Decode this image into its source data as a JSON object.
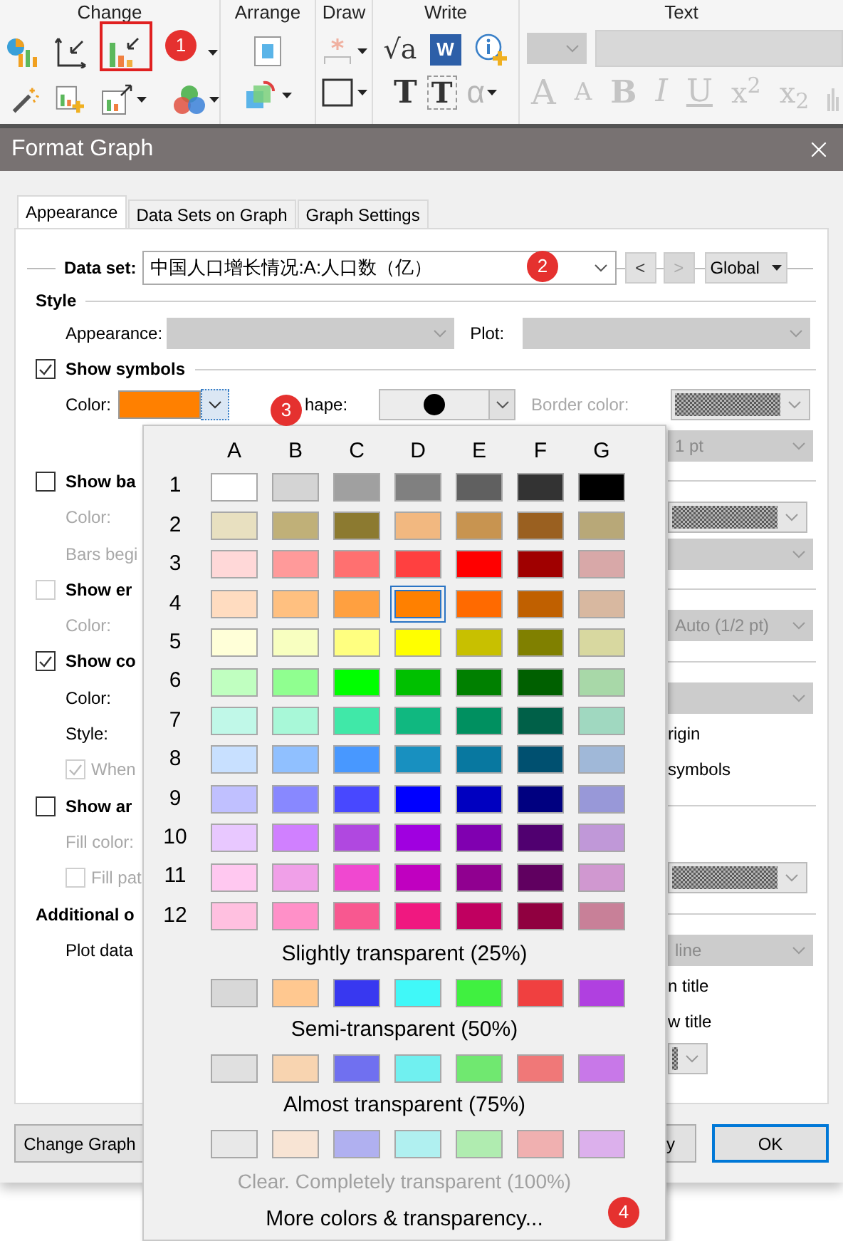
{
  "ribbon": {
    "groups": [
      {
        "label": "Change"
      },
      {
        "label": "Arrange"
      },
      {
        "label": "Draw"
      },
      {
        "label": "Write"
      },
      {
        "label": "Text"
      }
    ],
    "write_tools": [
      {
        "label": "√a",
        "disabled": false
      },
      {
        "label": "W",
        "disabled": false
      },
      {
        "label": "T",
        "disabled": false
      },
      {
        "label": "T",
        "disabled": false
      },
      {
        "label": "α",
        "disabled": true
      }
    ],
    "text_tools": [
      {
        "label": "A",
        "disabled": true
      },
      {
        "label": "A",
        "disabled": true
      },
      {
        "label": "B",
        "disabled": true
      },
      {
        "label": "I",
        "disabled": true
      },
      {
        "label": "U",
        "disabled": true
      },
      {
        "label": "x$^{2}$",
        "disabled": true
      },
      {
        "label": "x$_{2}$",
        "disabled": true
      }
    ]
  },
  "dialog": {
    "title": "Format Graph",
    "tabs": [
      {
        "label": "Appearance",
        "selected": true
      },
      {
        "label": "Data Sets on Graph",
        "selected": false
      },
      {
        "label": "Graph Settings",
        "selected": false
      }
    ],
    "data_set": {
      "label": "Data set:",
      "value": "中国人口增长情况:A:人口数（亿）",
      "prev": {
        "label": "<",
        "disabled": false
      },
      "next": {
        "label": ">",
        "disabled": true
      },
      "scope": "Global"
    },
    "style": {
      "heading": "Style",
      "appearance_label": "Appearance:",
      "plot_label": "Plot:"
    },
    "show_symbols": {
      "label": "Show symbols",
      "checked": true
    },
    "symbol_row": {
      "color_label": "Color:",
      "color": "#ff8000",
      "shape_label": "hape:",
      "border_label": "Border color:"
    },
    "rows": [
      {
        "right": {
          "kind": "combo",
          "value": "1 pt"
        }
      },
      {
        "left": {
          "kind": "check",
          "label": "Show ba",
          "checked": false,
          "disabled": false
        },
        "right": {
          "kind": "rule"
        }
      },
      {
        "left": {
          "kind": "label",
          "label": "Color:",
          "disabled": true
        },
        "right": {
          "kind": "hatched"
        }
      },
      {
        "left": {
          "kind": "label",
          "label": "Bars begi",
          "disabled": true
        },
        "right": {
          "kind": "combo"
        }
      },
      {
        "left": {
          "kind": "check",
          "label": "Show er",
          "checked": false,
          "disabled": true
        },
        "right": {
          "kind": "rule"
        }
      },
      {
        "left": {
          "kind": "label",
          "label": "Color:",
          "disabled": true
        },
        "right": {
          "kind": "combo",
          "value": "Auto (1/2 pt)"
        }
      },
      {
        "left": {
          "kind": "check",
          "label": "Show co",
          "checked": true,
          "disabled": false
        },
        "right": {
          "kind": "rule"
        }
      },
      {
        "left": {
          "kind": "label",
          "label": "Color:",
          "disabled": false
        },
        "right": {
          "kind": "combo"
        }
      },
      {
        "left": {
          "kind": "label",
          "label": "Style:",
          "disabled": false
        },
        "right": {
          "kind": "text",
          "label": "rigin"
        }
      },
      {
        "left": {
          "kind": "subcheck",
          "label": "When",
          "checked": true,
          "disabled": true
        },
        "right": {
          "kind": "text",
          "label": "symbols"
        }
      },
      {
        "left": {
          "kind": "check",
          "label": "Show ar",
          "checked": false,
          "disabled": false
        },
        "right": {
          "kind": "rule"
        }
      },
      {
        "left": {
          "kind": "label",
          "label": "Fill color:",
          "disabled": true
        }
      },
      {
        "left": {
          "kind": "subcheck",
          "label": "Fill pat",
          "checked": false,
          "disabled": true
        },
        "right": {
          "kind": "hatched"
        }
      },
      {
        "left": {
          "kind": "heading",
          "label": "Additional o"
        },
        "right": {
          "kind": "rule"
        }
      },
      {
        "left": {
          "kind": "label",
          "label": "Plot data",
          "disabled": false
        },
        "right": {
          "kind": "combo",
          "value": "line"
        }
      },
      {
        "right": {
          "kind": "text",
          "label": "n title"
        }
      },
      {
        "right": {
          "kind": "text",
          "label": "w title"
        }
      },
      {
        "right": {
          "kind": "hatched_small"
        }
      }
    ],
    "buttons": [
      {
        "label": "Change Graph",
        "default": false
      },
      {
        "label": "y",
        "default": false
      },
      {
        "label": "OK",
        "default": true
      }
    ]
  },
  "color_menu": {
    "columns": [
      "A",
      "B",
      "C",
      "D",
      "E",
      "F",
      "G"
    ],
    "rows": [
      {
        "label": "1",
        "swatches": [
          {
            "color": "#ffffff",
            "selected": false
          },
          {
            "color": "#d4d4d4",
            "selected": false
          },
          {
            "color": "#a0a0a0",
            "selected": false
          },
          {
            "color": "#808080",
            "selected": false
          },
          {
            "color": "#606060",
            "selected": false
          },
          {
            "color": "#333333",
            "selected": false
          },
          {
            "color": "#000000",
            "selected": false
          }
        ]
      },
      {
        "label": "2",
        "swatches": [
          {
            "color": "#e8e0c0",
            "selected": false
          },
          {
            "color": "#c0b078",
            "selected": false
          },
          {
            "color": "#8c7a30",
            "selected": false
          },
          {
            "color": "#f2b880",
            "selected": false
          },
          {
            "color": "#c89450",
            "selected": false
          },
          {
            "color": "#9a6020",
            "selected": false
          },
          {
            "color": "#b8a878",
            "selected": false
          }
        ]
      },
      {
        "label": "3",
        "swatches": [
          {
            "color": "#ffd8d8",
            "selected": false
          },
          {
            "color": "#ff9a9a",
            "selected": false
          },
          {
            "color": "#ff7070",
            "selected": false
          },
          {
            "color": "#ff4040",
            "selected": false
          },
          {
            "color": "#ff0000",
            "selected": false
          },
          {
            "color": "#a00000",
            "selected": false
          },
          {
            "color": "#d8a8a8",
            "selected": false
          }
        ]
      },
      {
        "label": "4",
        "swatches": [
          {
            "color": "#ffdcc0",
            "selected": false
          },
          {
            "color": "#ffc080",
            "selected": false
          },
          {
            "color": "#ffa040",
            "selected": false
          },
          {
            "color": "#ff8000",
            "selected": true
          },
          {
            "color": "#ff6a00",
            "selected": false
          },
          {
            "color": "#c06000",
            "selected": false
          },
          {
            "color": "#d8b8a0",
            "selected": false
          }
        ]
      },
      {
        "label": "5",
        "swatches": [
          {
            "color": "#ffffd8",
            "selected": false
          },
          {
            "color": "#f8ffc0",
            "selected": false
          },
          {
            "color": "#ffff80",
            "selected": false
          },
          {
            "color": "#ffff00",
            "selected": false
          },
          {
            "color": "#c8c000",
            "selected": false
          },
          {
            "color": "#808000",
            "selected": false
          },
          {
            "color": "#d8d8a0",
            "selected": false
          }
        ]
      },
      {
        "label": "6",
        "swatches": [
          {
            "color": "#c0ffc0",
            "selected": false
          },
          {
            "color": "#90ff90",
            "selected": false
          },
          {
            "color": "#00ff00",
            "selected": false
          },
          {
            "color": "#00c000",
            "selected": false
          },
          {
            "color": "#008000",
            "selected": false
          },
          {
            "color": "#006000",
            "selected": false
          },
          {
            "color": "#a8d8a8",
            "selected": false
          }
        ]
      },
      {
        "label": "7",
        "swatches": [
          {
            "color": "#c0f8e8",
            "selected": false
          },
          {
            "color": "#a8f8d8",
            "selected": false
          },
          {
            "color": "#40e8a8",
            "selected": false
          },
          {
            "color": "#10b880",
            "selected": false
          },
          {
            "color": "#009060",
            "selected": false
          },
          {
            "color": "#006048",
            "selected": false
          },
          {
            "color": "#a0d8c0",
            "selected": false
          }
        ]
      },
      {
        "label": "8",
        "swatches": [
          {
            "color": "#c8e0ff",
            "selected": false
          },
          {
            "color": "#90c0ff",
            "selected": false
          },
          {
            "color": "#4898ff",
            "selected": false
          },
          {
            "color": "#1890c0",
            "selected": false
          },
          {
            "color": "#0878a0",
            "selected": false
          },
          {
            "color": "#005070",
            "selected": false
          },
          {
            "color": "#a0b8d8",
            "selected": false
          }
        ]
      },
      {
        "label": "9",
        "swatches": [
          {
            "color": "#c0c0ff",
            "selected": false
          },
          {
            "color": "#8888ff",
            "selected": false
          },
          {
            "color": "#4848ff",
            "selected": false
          },
          {
            "color": "#0000ff",
            "selected": false
          },
          {
            "color": "#0000c0",
            "selected": false
          },
          {
            "color": "#000080",
            "selected": false
          },
          {
            "color": "#9898d8",
            "selected": false
          }
        ]
      },
      {
        "label": "10",
        "swatches": [
          {
            "color": "#e8c8ff",
            "selected": false
          },
          {
            "color": "#d080ff",
            "selected": false
          },
          {
            "color": "#b048e0",
            "selected": false
          },
          {
            "color": "#a000e0",
            "selected": false
          },
          {
            "color": "#8000b0",
            "selected": false
          },
          {
            "color": "#500070",
            "selected": false
          },
          {
            "color": "#c098d8",
            "selected": false
          }
        ]
      },
      {
        "label": "11",
        "swatches": [
          {
            "color": "#ffc8f0",
            "selected": false
          },
          {
            "color": "#f0a0e8",
            "selected": false
          },
          {
            "color": "#f048d0",
            "selected": false
          },
          {
            "color": "#c000c0",
            "selected": false
          },
          {
            "color": "#900090",
            "selected": false
          },
          {
            "color": "#600060",
            "selected": false
          },
          {
            "color": "#d098d0",
            "selected": false
          }
        ]
      },
      {
        "label": "12",
        "swatches": [
          {
            "color": "#ffc0e0",
            "selected": false
          },
          {
            "color": "#ff90c8",
            "selected": false
          },
          {
            "color": "#f85890",
            "selected": false
          },
          {
            "color": "#f01880",
            "selected": false
          },
          {
            "color": "#c00060",
            "selected": false
          },
          {
            "color": "#900040",
            "selected": false
          },
          {
            "color": "#c88098",
            "selected": false
          }
        ]
      }
    ],
    "transparency": [
      {
        "title": "Slightly transparent (25%)",
        "swatches": [
          {
            "color": "#d8d8d8",
            "selected": false
          },
          {
            "color": "#ffc890",
            "selected": false
          },
          {
            "color": "#3838f0",
            "selected": false
          },
          {
            "color": "#40f8f8",
            "selected": false
          },
          {
            "color": "#40f040",
            "selected": false
          },
          {
            "color": "#f04040",
            "selected": false
          },
          {
            "color": "#b040e0",
            "selected": false
          }
        ]
      },
      {
        "title": "Semi-transparent (50%)",
        "swatches": [
          {
            "color": "#e0e0e0",
            "selected": false
          },
          {
            "color": "#f8d4b0",
            "selected": false
          },
          {
            "color": "#7070f0",
            "selected": false
          },
          {
            "color": "#70f0f0",
            "selected": false
          },
          {
            "color": "#70e870",
            "selected": false
          },
          {
            "color": "#f07878",
            "selected": false
          },
          {
            "color": "#c878e8",
            "selected": false
          }
        ]
      },
      {
        "title": "Almost transparent (75%)",
        "swatches": [
          {
            "color": "#e8e8e8",
            "selected": false
          },
          {
            "color": "#f8e4d4",
            "selected": false
          },
          {
            "color": "#b0b0f0",
            "selected": false
          },
          {
            "color": "#b0f0f0",
            "selected": false
          },
          {
            "color": "#b0ecb0",
            "selected": false
          },
          {
            "color": "#f0b0b0",
            "selected": false
          },
          {
            "color": "#dcb0ec",
            "selected": false
          }
        ]
      }
    ],
    "clear": {
      "label": "Clear. Completely transparent (100%)",
      "disabled": true
    },
    "more": "More colors & transparency..."
  },
  "annotations": [
    {
      "kind": "box"
    },
    {
      "kind": "badge",
      "label": "1"
    },
    {
      "kind": "badge",
      "label": "2"
    },
    {
      "kind": "badge",
      "label": "3"
    },
    {
      "kind": "badge",
      "label": "4"
    }
  ]
}
